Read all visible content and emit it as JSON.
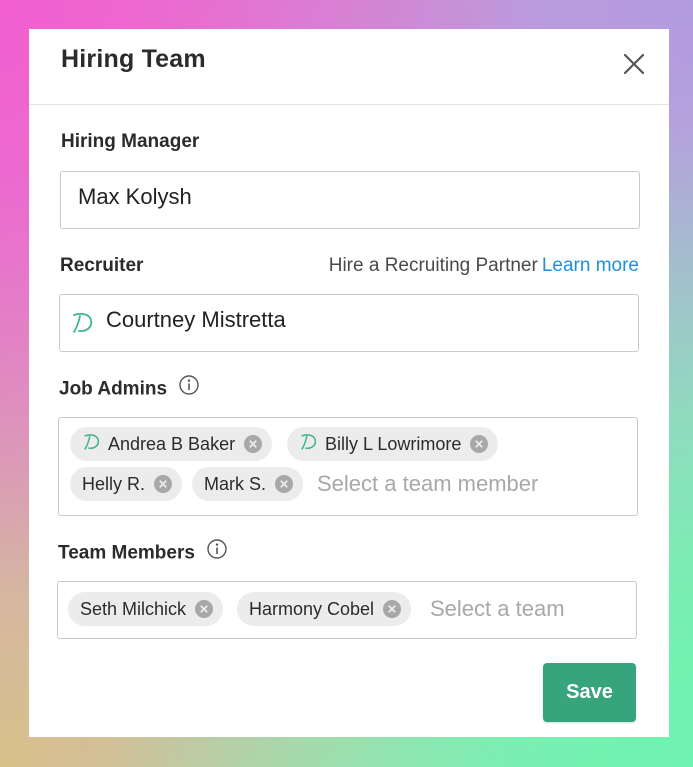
{
  "dialog": {
    "title": "Hiring Team",
    "close_icon": "close-icon"
  },
  "hiring_manager": {
    "label": "Hiring Manager",
    "value": "Max Kolysh"
  },
  "recruiter": {
    "label": "Recruiter",
    "partner_text": "Hire a Recruiting Partner",
    "partner_link": "Learn more",
    "value": "Courtney Mistretta",
    "icon": "dover-logo-icon"
  },
  "job_admins": {
    "label": "Job Admins",
    "info_icon": "info-icon",
    "chips": [
      {
        "name": "Andrea B Baker"
      },
      {
        "name": "Billy L Lowrimore"
      },
      {
        "name": "Helly R."
      },
      {
        "name": "Mark S."
      }
    ],
    "placeholder": "Select a team member"
  },
  "team_members": {
    "label": "Team Members",
    "info_icon": "info-icon",
    "chips": [
      {
        "name": "Seth Milchick"
      },
      {
        "name": "Harmony Cobel"
      }
    ],
    "placeholder": "Select a team"
  },
  "actions": {
    "save_label": "Save"
  },
  "colors": {
    "accent_link": "#1d8fe0",
    "save_button": "#36a47c",
    "logo_teal": "#3fb58e"
  }
}
